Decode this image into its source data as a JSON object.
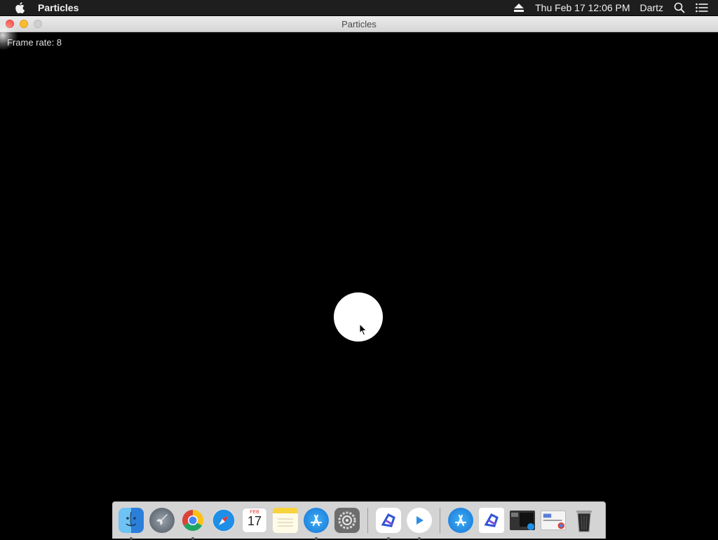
{
  "menubar": {
    "app_name": "Particles",
    "datetime": "Thu Feb 17  12:06 PM",
    "user": "Dartz",
    "icons": [
      "apple-icon",
      "eject-icon",
      "spotlight-icon",
      "notification-center-icon"
    ]
  },
  "window": {
    "title": "Particles",
    "frame_rate_label": "Frame rate: 8"
  },
  "dock": {
    "calendar_month": "FEB",
    "calendar_day": "17",
    "items": [
      {
        "name": "Finder",
        "icon": "finder-icon"
      },
      {
        "name": "Launchpad",
        "icon": "launchpad-icon"
      },
      {
        "name": "Google Chrome",
        "icon": "chrome-icon"
      },
      {
        "name": "Safari",
        "icon": "safari-icon"
      },
      {
        "name": "Calendar",
        "icon": "calendar-icon"
      },
      {
        "name": "Notes",
        "icon": "notes-icon"
      },
      {
        "name": "App Store",
        "icon": "app-store-icon"
      },
      {
        "name": "System Preferences",
        "icon": "system-preferences-icon"
      },
      {
        "name": "Dart app",
        "icon": "dart-app-icon"
      },
      {
        "name": "Play app",
        "icon": "play-icon"
      },
      {
        "name": "App Store folder",
        "icon": "app-store-folder-icon"
      },
      {
        "name": "Document",
        "icon": "document-icon"
      },
      {
        "name": "Screenshot 1",
        "icon": "screenshot-thumbnail-icon"
      },
      {
        "name": "Screenshot 2",
        "icon": "screenshot-thumbnail-icon"
      },
      {
        "name": "Trash",
        "icon": "trash-icon"
      }
    ]
  },
  "colors": {
    "menubar_bg": "#1e1e1e",
    "canvas_bg": "#000000",
    "particle": "#ffffff"
  }
}
